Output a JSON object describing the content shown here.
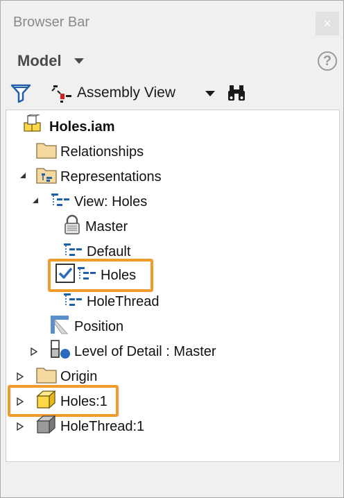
{
  "window": {
    "title": "Browser Bar",
    "close_glyph": "×"
  },
  "header": {
    "model_label": "Model",
    "help_glyph": "?"
  },
  "toolbar": {
    "view_label": "Assembly View"
  },
  "tree": {
    "root": "Holes.iam",
    "relationships": "Relationships",
    "representations": "Representations",
    "view": "View: Holes",
    "master": "Master",
    "default": "Default",
    "holes_view": "Holes",
    "holethread_view": "HoleThread",
    "position": "Position",
    "lod": "Level of Detail : Master",
    "origin": "Origin",
    "holes_part": "Holes:1",
    "holethread_part": "HoleThread:1"
  },
  "colors": {
    "highlight": "#f39a2d",
    "folder": "#f5d9a0",
    "part_yellow": "#ffd84a",
    "part_grey": "#9a9a9a",
    "view_blue": "#1f5fa8"
  }
}
